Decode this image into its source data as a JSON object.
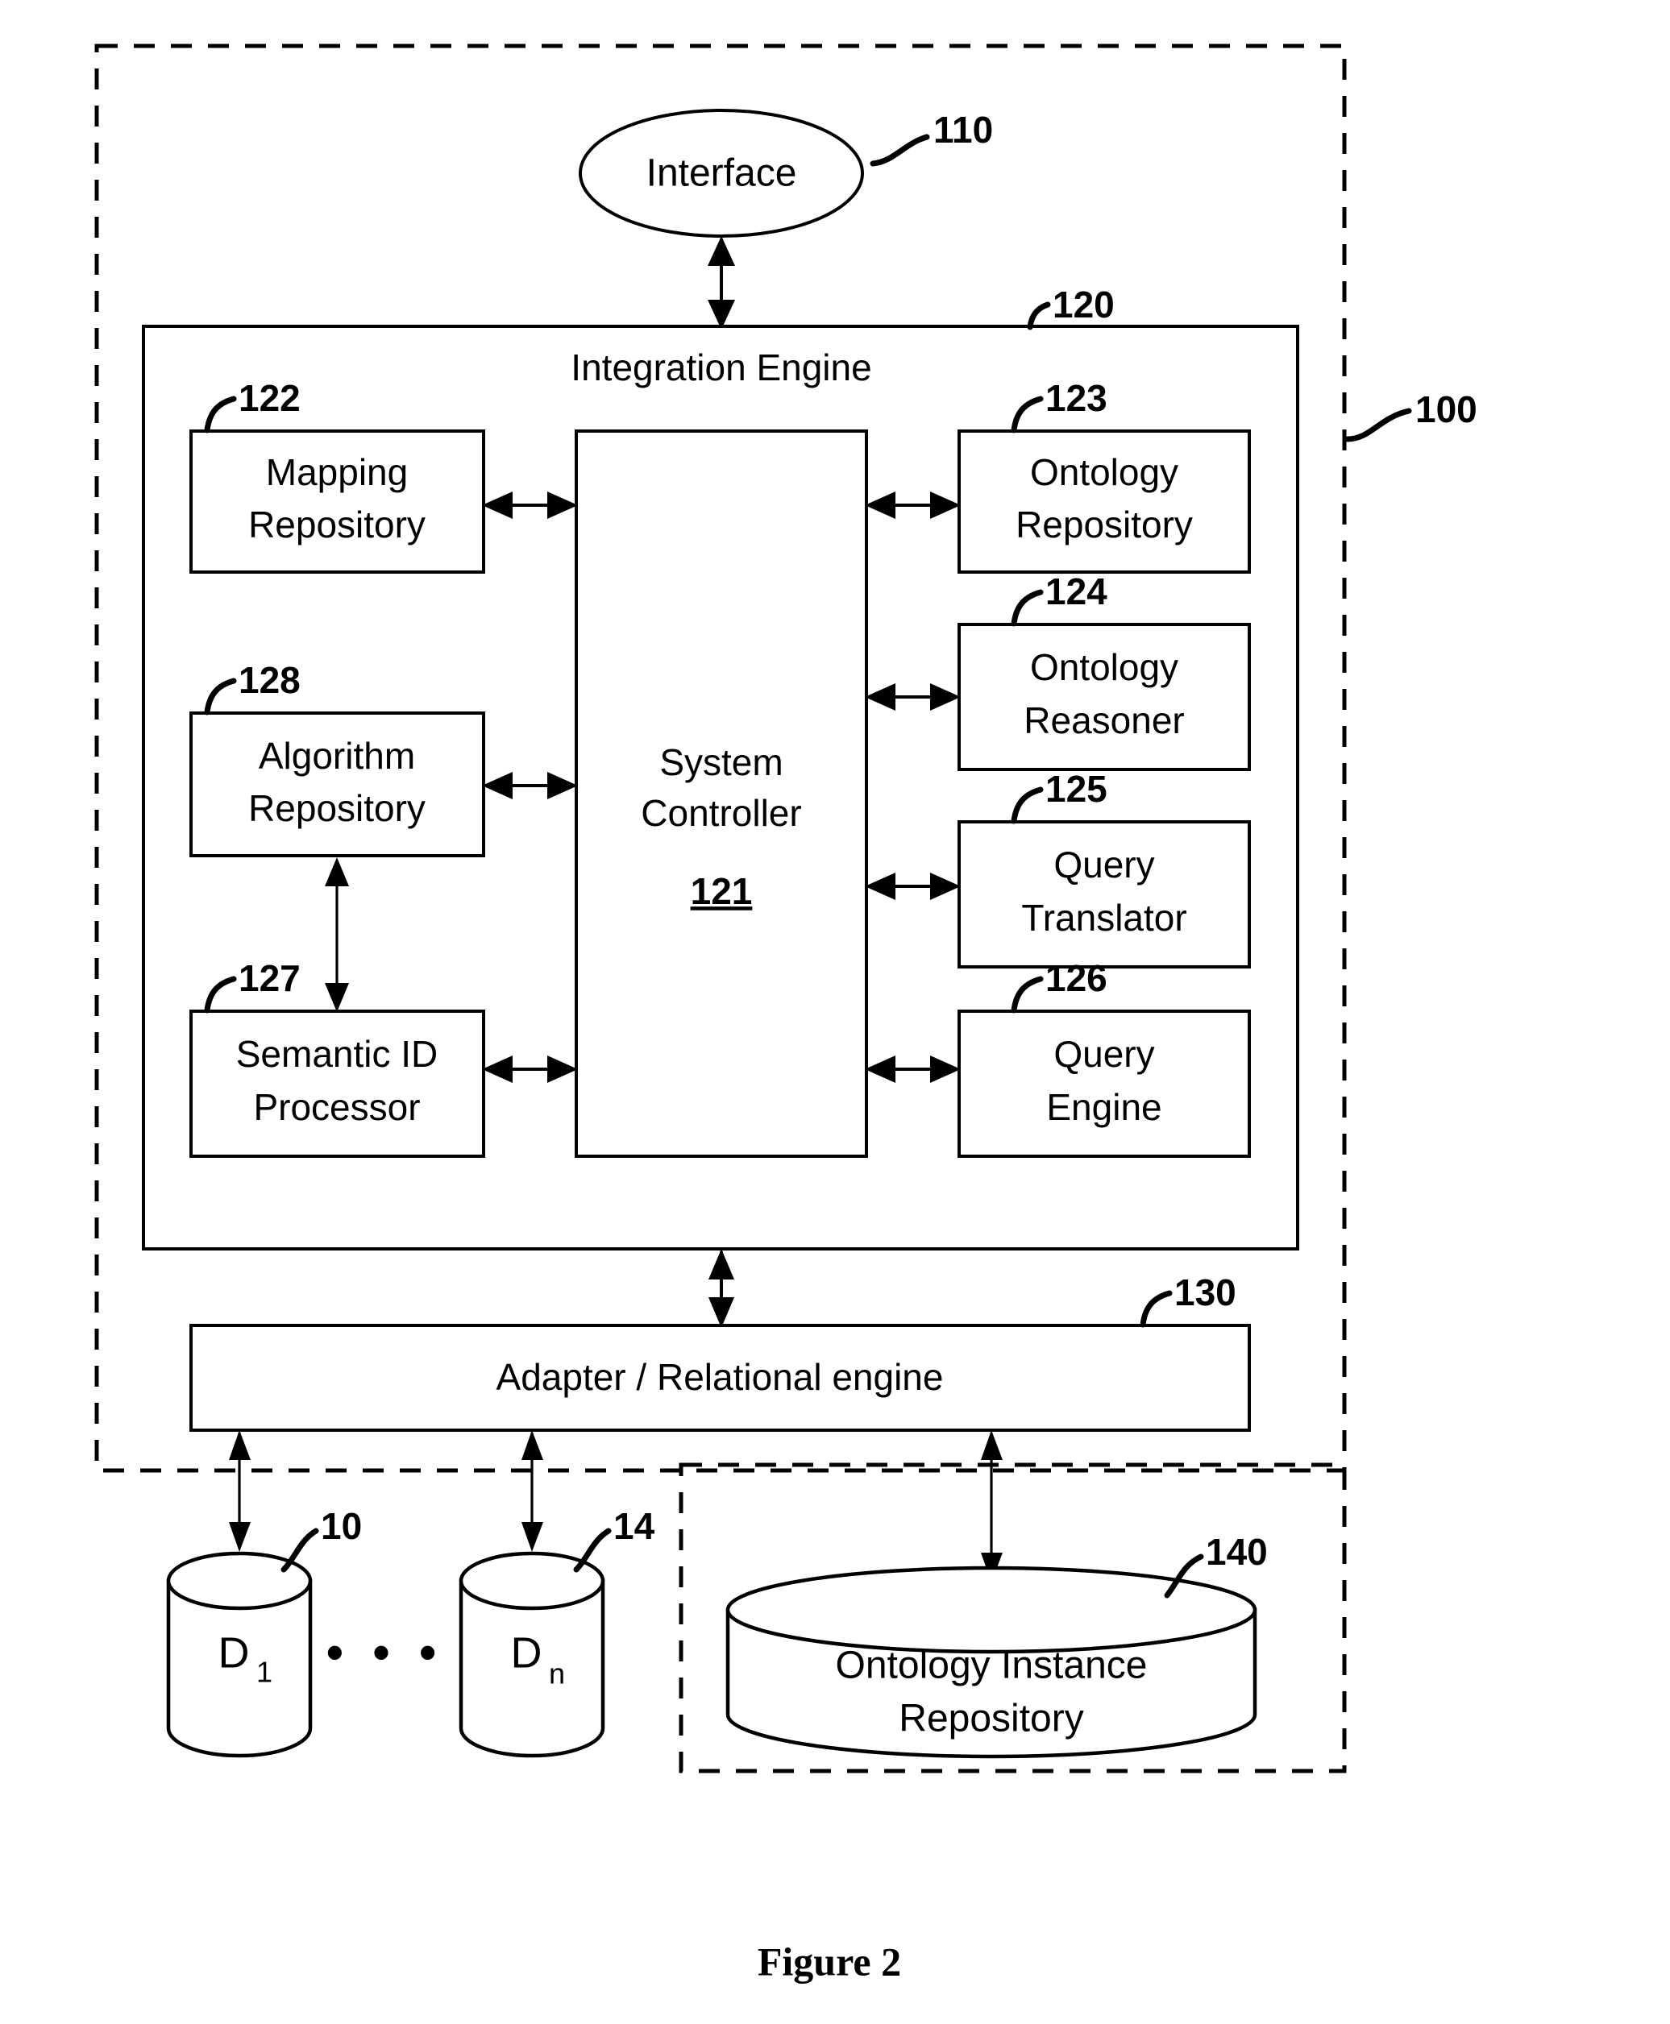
{
  "figure": {
    "caption": "Figure 2",
    "system_ref": "100"
  },
  "interface": {
    "label": "Interface",
    "ref": "110"
  },
  "integration_engine": {
    "title": "Integration Engine",
    "ref": "120",
    "controller": {
      "line1": "System",
      "line2": "Controller",
      "ref": "121"
    },
    "left_modules": [
      {
        "line1": "Mapping",
        "line2": "Repository",
        "ref": "122"
      },
      {
        "line1": "Algorithm",
        "line2": "Repository",
        "ref": "128"
      },
      {
        "line1": "Semantic ID",
        "line2": "Processor",
        "ref": "127"
      }
    ],
    "right_modules": [
      {
        "line1": "Ontology",
        "line2": "Repository",
        "ref": "123"
      },
      {
        "line1": "Ontology",
        "line2": "Reasoner",
        "ref": "124"
      },
      {
        "line1": "Query",
        "line2": "Translator",
        "ref": "125"
      },
      {
        "line1": "Query",
        "line2": "Engine",
        "ref": "126"
      }
    ]
  },
  "adapter": {
    "label": "Adapter / Relational engine",
    "ref": "130"
  },
  "data_sources": {
    "first": {
      "label": "D",
      "subscript": "1",
      "ref": "10"
    },
    "ellipsis": "• • •",
    "last": {
      "label": "D",
      "subscript": "n",
      "ref": "14"
    }
  },
  "ontology_instance_repository": {
    "line1": "Ontology Instance",
    "line2": "Repository",
    "ref": "140"
  }
}
